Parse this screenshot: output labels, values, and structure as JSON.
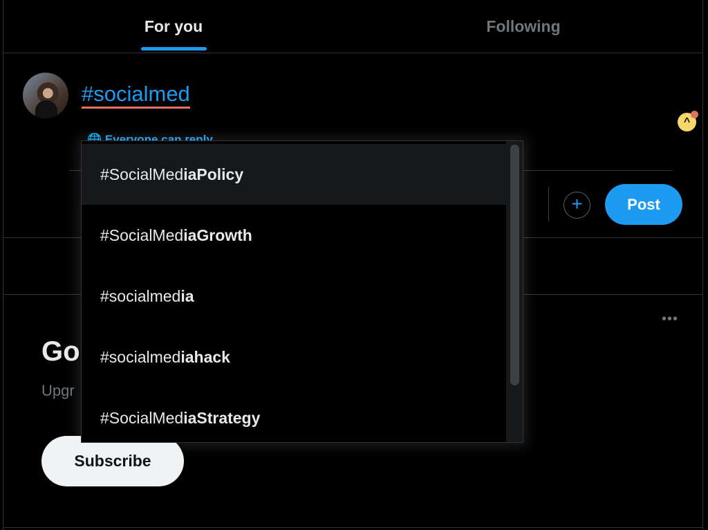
{
  "tabs": [
    {
      "label": "For you",
      "active": true
    },
    {
      "label": "Following",
      "active": false
    }
  ],
  "compose": {
    "text": "#socialmed",
    "reply_setting": "Everyone can reply",
    "post_label": "Post",
    "add_icon": "plus-circle-icon"
  },
  "suggestions": [
    {
      "prefix": "#SocialMed",
      "suffix": "iaPolicy"
    },
    {
      "prefix": "#SocialMed",
      "suffix": "iaGrowth"
    },
    {
      "prefix": "#socialmed",
      "suffix": "ia"
    },
    {
      "prefix": "#socialmed",
      "suffix": "iahack"
    },
    {
      "prefix": "#SocialMed",
      "suffix": "iaStrategy"
    }
  ],
  "premium": {
    "title": "Go",
    "subtitle": "Upgr",
    "subscribe_label": "Subscribe",
    "more_icon": "more-dots-icon"
  },
  "colors": {
    "accent": "#1d9bf0",
    "background": "#000000",
    "spell_underline": "#e0735e"
  }
}
